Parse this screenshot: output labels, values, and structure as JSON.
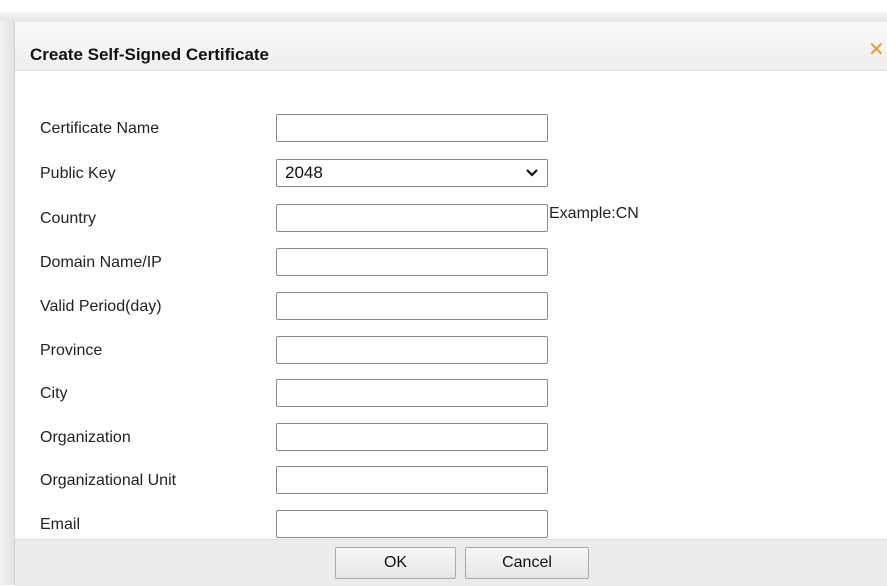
{
  "dialog": {
    "title": "Create Self-Signed Certificate",
    "close_icon": "close-icon"
  },
  "fields": [
    {
      "key": "certificate_name",
      "label": "Certificate Name",
      "value": "",
      "type": "text"
    },
    {
      "key": "public_key",
      "label": "Public Key",
      "value": "2048",
      "type": "select"
    },
    {
      "key": "country",
      "label": "Country",
      "value": "",
      "type": "text",
      "hint": "Example:CN"
    },
    {
      "key": "domain_name_ip",
      "label": "Domain Name/IP",
      "value": "",
      "type": "text"
    },
    {
      "key": "valid_period",
      "label": "Valid Period(day)",
      "value": "",
      "type": "text"
    },
    {
      "key": "province",
      "label": "Province",
      "value": "",
      "type": "text"
    },
    {
      "key": "city",
      "label": "City",
      "value": "",
      "type": "text"
    },
    {
      "key": "organization",
      "label": "Organization",
      "value": "",
      "type": "text"
    },
    {
      "key": "organizational_unit",
      "label": "Organizational Unit",
      "value": "",
      "type": "text"
    },
    {
      "key": "email",
      "label": "Email",
      "value": "",
      "type": "text"
    }
  ],
  "footer": {
    "ok_label": "OK",
    "cancel_label": "Cancel"
  },
  "colors": {
    "close_icon": "#e39a2e",
    "footer_bg": "#ececec"
  }
}
